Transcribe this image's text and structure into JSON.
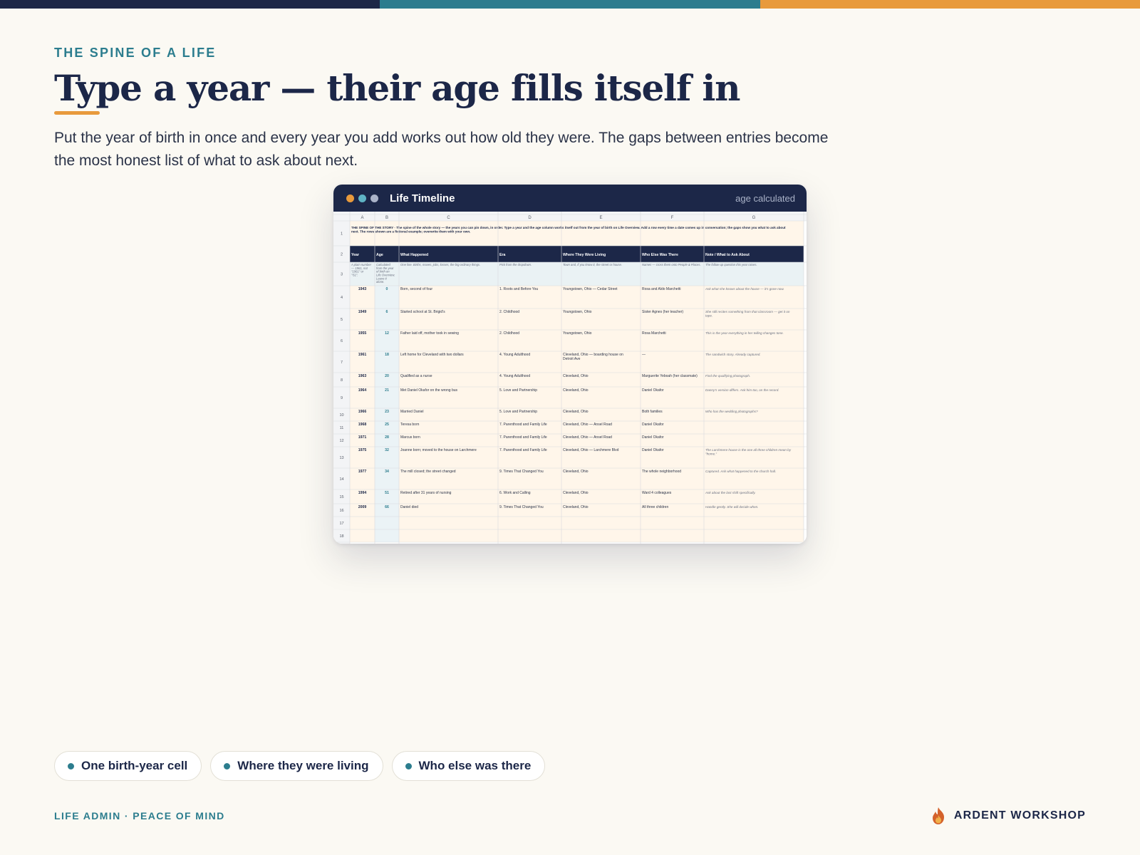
{
  "colors": {
    "navy": "#1c2748",
    "teal": "#2c7d8e",
    "orange": "#e89a3c",
    "background": "#fbf9f3",
    "row_fill": "#fff6ea",
    "age_fill": "#ebf3f6"
  },
  "topbar": {
    "segments": [
      "#1c2748",
      "#2c7d8e",
      "#e89a3c"
    ]
  },
  "slide": {
    "eyebrow": "THE SPINE OF A LIFE",
    "headline": "Type a year — their age fills itself in",
    "lede": "Put the year of birth in once and every year you add works out how old they were. The gaps between entries become the most honest list of what to ask about next."
  },
  "window": {
    "title": "Life Timeline",
    "status": "age calculated",
    "dots": [
      "#e89a3c",
      "#5fb3c4",
      "#aab3c8"
    ]
  },
  "sheet": {
    "columns": [
      "A",
      "B",
      "C",
      "D",
      "E",
      "F",
      "G"
    ],
    "banner": "THE SPINE OF THE STORY · The spine of the whole story — the years you can pin down, in order. Type a year and the age column works itself out from the year of birth on Life Overview. Add a row every time a date comes up in conversation; the gaps show you what to ask about next. The rows shown are a fictional example; overwrite them with your own.",
    "headers": [
      "Year",
      "Age",
      "What Happened",
      "Era",
      "Where They Were Living",
      "Who Else Was There",
      "Note / What to Ask About"
    ],
    "hints": [
      "A plain number — 1961, not \"1961\" or \"'61\".",
      "Calculated from the year of birth on Life Overview. Leave it alone.",
      "One line. Births, moves, jobs, losses, the big ordinary things.",
      "Pick from the dropdown.",
      "Town and, if you know it, the street or house.",
      "Names — cross them onto People & Places.",
      "The follow-up question this year raises."
    ],
    "rows": [
      [
        "1943",
        "0",
        "Born, second of four",
        "1. Roots and Before You",
        "Youngstown, Ohio — Cedar Street",
        "Rosa and Aldo Marchetti",
        "Ask what she knows about the house — it's gone now."
      ],
      [
        "1949",
        "6",
        "Started school at St. Brigid's",
        "2. Childhood",
        "Youngstown, Ohio",
        "Sister Agnes (her teacher)",
        "She still recites something from that classroom — get it on tape."
      ],
      [
        "1955",
        "12",
        "Father laid off, mother took in sewing",
        "2. Childhood",
        "Youngstown, Ohio",
        "Rosa Marchetti",
        "This is the year everything in her telling changes tone."
      ],
      [
        "1961",
        "18",
        "Left home for Cleveland with two dollars",
        "4. Young Adulthood",
        "Cleveland, Ohio — boarding house on Detroit Ave",
        "—",
        "The sandwich story. Already captured."
      ],
      [
        "1963",
        "20",
        "Qualified as a nurse",
        "4. Young Adulthood",
        "Cleveland, Ohio",
        "Marguerite Yeboah (her classmate)",
        "Find the qualifying photograph."
      ],
      [
        "1964",
        "21",
        "Met Daniel Okafor on the wrong bus",
        "5. Love and Partnership",
        "Cleveland, Ohio",
        "Daniel Okafor",
        "Danny's version differs. Ask him too, on the record."
      ],
      [
        "1966",
        "23",
        "Married Daniel",
        "5. Love and Partnership",
        "Cleveland, Ohio",
        "Both families",
        "Who has the wedding photographs?"
      ],
      [
        "1968",
        "25",
        "Teresa born",
        "7. Parenthood and Family Life",
        "Cleveland, Ohio — Ansel Road",
        "Daniel Okafor",
        ""
      ],
      [
        "1971",
        "28",
        "Marcus born",
        "7. Parenthood and Family Life",
        "Cleveland, Ohio — Ansel Road",
        "Daniel Okafor",
        ""
      ],
      [
        "1975",
        "32",
        "Joanne born; moved to the house on Larchmere",
        "7. Parenthood and Family Life",
        "Cleveland, Ohio — Larchmere Blvd",
        "Daniel Okafor",
        "The Larchmere house is the one all three children mean by \"home.\""
      ],
      [
        "1977",
        "34",
        "The mill closed; the street changed",
        "9. Times That Changed You",
        "Cleveland, Ohio",
        "The whole neighborhood",
        "Captured. Ask what happened to the church hall."
      ],
      [
        "1994",
        "51",
        "Retired after 31 years of nursing",
        "6. Work and Calling",
        "Cleveland, Ohio",
        "Ward 4 colleagues",
        "Ask about the last shift specifically."
      ],
      [
        "2009",
        "66",
        "Daniel died",
        "9. Times That Changed You",
        "Cleveland, Ohio",
        "All three children",
        "Handle gently. She will decide when."
      ],
      [
        "",
        "",
        "",
        "",
        "",
        "",
        ""
      ],
      [
        "",
        "",
        "",
        "",
        "",
        "",
        ""
      ]
    ]
  },
  "chips": [
    "One birth-year cell",
    "Where they were living",
    "Who else was there"
  ],
  "footer": {
    "left": "LIFE ADMIN · PEACE OF MIND",
    "brand": "ARDENT WORKSHOP",
    "brand_icon": "flame-icon"
  }
}
